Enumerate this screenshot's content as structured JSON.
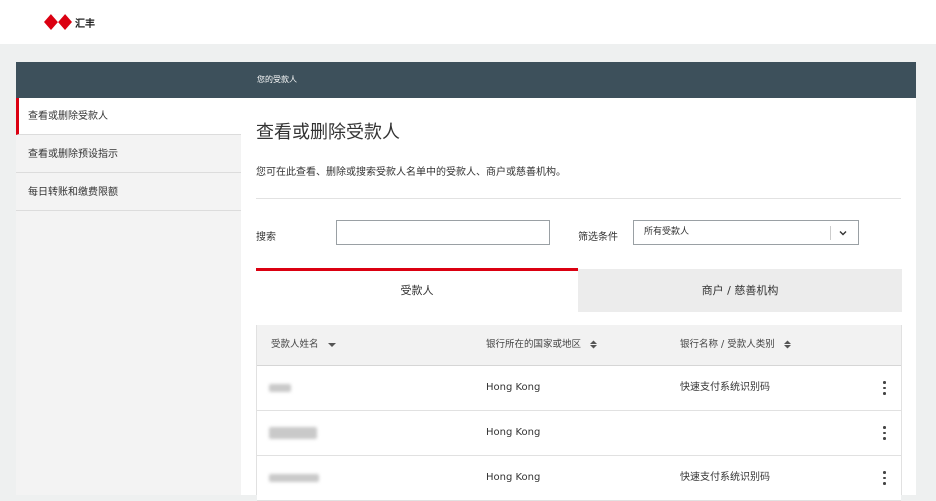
{
  "brand": {
    "logo_text": "汇丰",
    "color": "#db0011"
  },
  "header": {
    "title": "您的受款人"
  },
  "sidebar": {
    "items": [
      {
        "label": "查看或删除受款人",
        "active": true
      },
      {
        "label": "查看或删除预设指示",
        "active": false
      },
      {
        "label": "每日转账和缴费限额",
        "active": false
      }
    ]
  },
  "main": {
    "title": "查看或删除受款人",
    "description": "您可在此查看、删除或搜索受款人名单中的受款人、商户或慈善机构。",
    "search": {
      "label": "搜索",
      "value": "",
      "placeholder": ""
    },
    "filter": {
      "label": "筛选条件",
      "selected": "所有受款人"
    },
    "tabs": [
      {
        "label": "受款人",
        "active": true
      },
      {
        "label": "商户 / 慈善机构",
        "active": false
      }
    ],
    "table": {
      "columns": [
        "受款人姓名",
        "银行所在的国家或地区",
        "银行名称 / 受款人类别"
      ],
      "rows": [
        {
          "name": "",
          "country": "Hong Kong",
          "bank": "快速支付系统识别码"
        },
        {
          "name": "",
          "country": "Hong Kong",
          "bank": ""
        },
        {
          "name": "",
          "country": "Hong Kong",
          "bank": "快速支付系统识别码"
        }
      ]
    }
  },
  "colors": {
    "header_bg": "#3d505b",
    "accent": "#db0011",
    "page_bg": "#eef0f0"
  }
}
